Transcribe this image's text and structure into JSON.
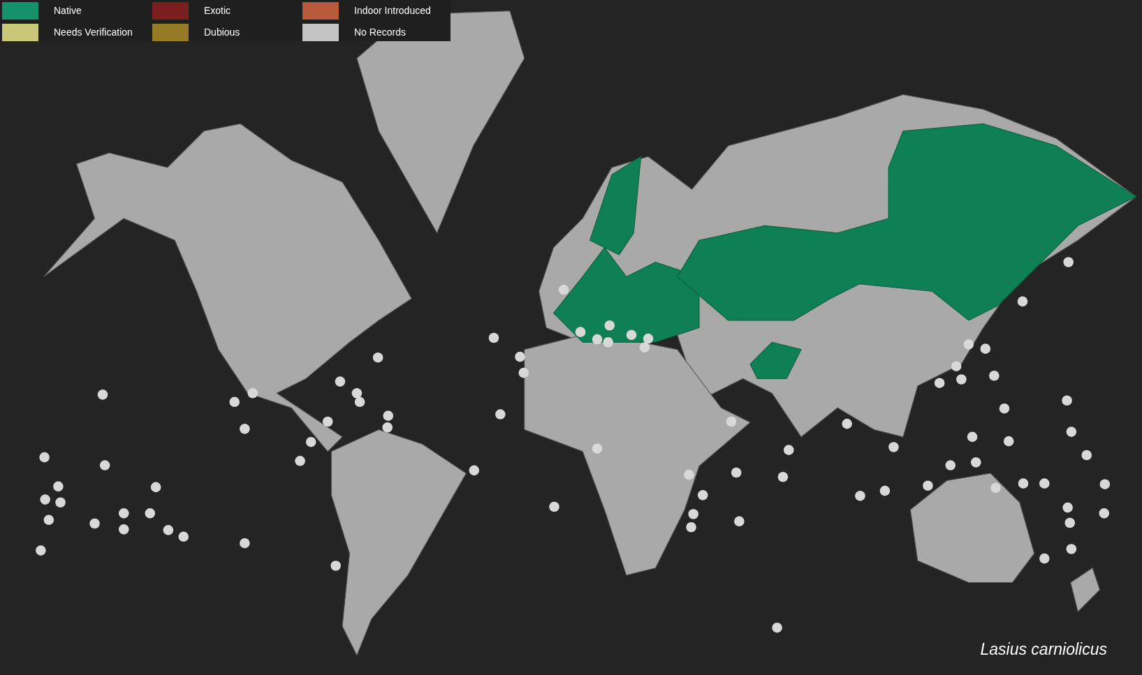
{
  "legend": [
    {
      "label": "Native",
      "color": "#14936a"
    },
    {
      "label": "Needs Verification",
      "color": "#c8c878"
    },
    {
      "label": "Exotic",
      "color": "#7a1e1e"
    },
    {
      "label": "Dubious",
      "color": "#957a28"
    },
    {
      "label": "Indoor Introduced",
      "color": "#b85a3c"
    },
    {
      "label": "No Records",
      "color": "#c4c4c4"
    }
  ],
  "species_name": "Lasius carniolicus"
}
